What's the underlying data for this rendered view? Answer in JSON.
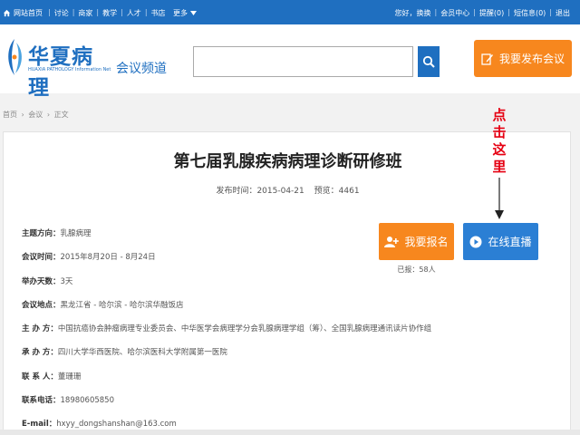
{
  "topnav": {
    "home": "网站首页",
    "links": [
      "讨论",
      "商家",
      "教学",
      "人才",
      "书店"
    ],
    "more": "更多",
    "right": [
      "您好，换换",
      "会员中心",
      "提醒(0)",
      "短信息(0)",
      "退出"
    ]
  },
  "header": {
    "logo_title": "华夏病理",
    "logo_sub": "HUAXIA PATHOLOGY Information Net",
    "channel": "会议频道",
    "search_value": "",
    "publish_label": "我要发布会议"
  },
  "breadcrumb": [
    "首页",
    "›",
    "会议",
    "›",
    "正文"
  ],
  "annotation": "点击这里",
  "article": {
    "title": "第七届乳腺疾病病理诊断研修班",
    "publish_time": "发布时间：2015-04-21",
    "views": "预览：4461",
    "fields": [
      {
        "k": "主题方向：",
        "v": "乳腺病理"
      },
      {
        "k": "会议时间：",
        "v": "2015年8月20日 - 8月24日"
      },
      {
        "k": "举办天数：",
        "v": "3天"
      },
      {
        "k": "会议地点：",
        "v": "黑龙江省 - 哈尔滨 - 哈尔滨华融饭店"
      },
      {
        "k": "主 办 方：",
        "v": "中国抗癌协会肿瘤病理专业委员会、中华医学会病理学分会乳腺病理学组（筹）、全国乳腺病理通讯读片协作组"
      },
      {
        "k": "承 办 方：",
        "v": "四川大学华西医院、哈尔滨医科大学附属第一医院"
      },
      {
        "k": "联 系 人：",
        "v": "董珊珊"
      },
      {
        "k": "联系电话：",
        "v": "18980605850"
      },
      {
        "k": "E-mail：",
        "v": "hxyy_dongshanshan@163.com"
      }
    ],
    "signup_label": "我要报名",
    "live_label": "在线直播",
    "registered": "已报：58人"
  },
  "colors": {
    "nav": "#1f6fc0",
    "orange": "#f7871e",
    "blue": "#2b7fd4",
    "annotation": "#e60012"
  }
}
